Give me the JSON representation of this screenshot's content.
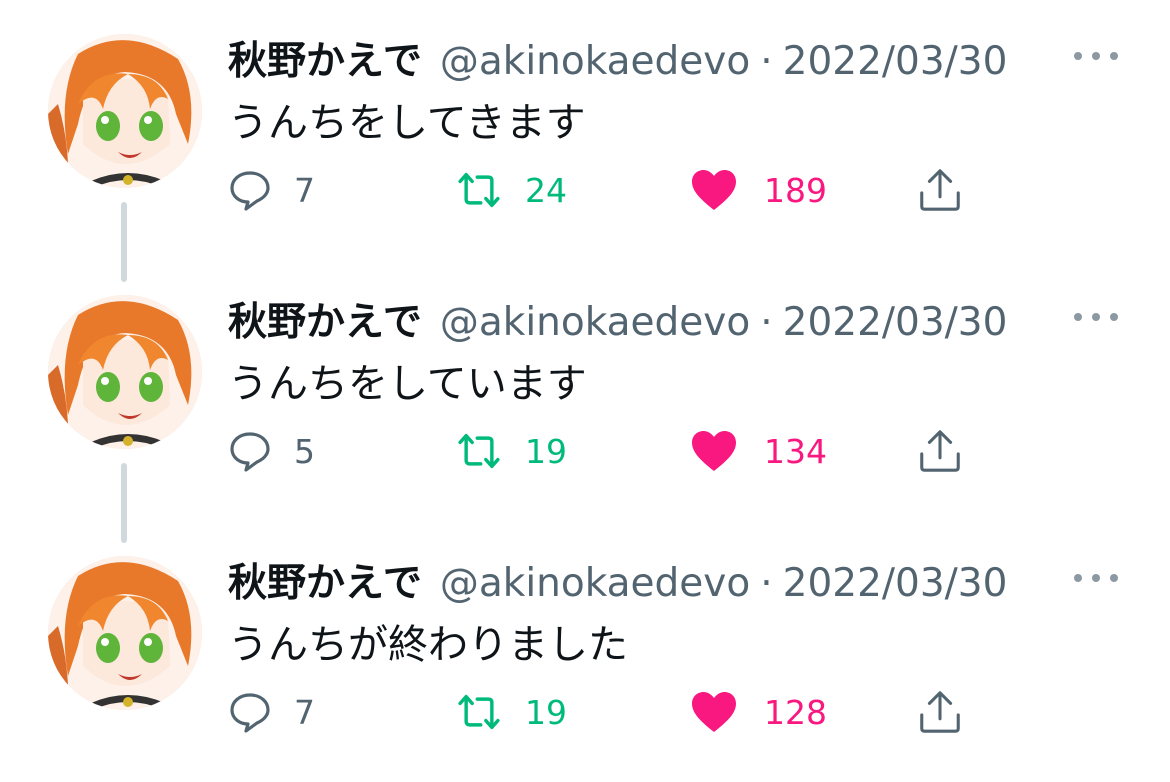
{
  "colors": {
    "name": "#0f1419",
    "secondary": "#536471",
    "retweet": "#00ba7c",
    "like": "#f91880",
    "connector": "#cfd9de"
  },
  "icons": {
    "reply": "speech-bubble-icon",
    "retweet": "retweet-arrows-icon",
    "like": "heart-filled-icon",
    "share": "share-upload-icon",
    "more": "ellipsis-icon"
  },
  "tweets": [
    {
      "name": "秋野かえで",
      "handle": "@akinokaedevo",
      "separator": "·",
      "date": "2022/03/30",
      "text": "うんちをしてきます",
      "replies": "7",
      "retweets": "24",
      "likes": "189"
    },
    {
      "name": "秋野かえで",
      "handle": "@akinokaedevo",
      "separator": "·",
      "date": "2022/03/30",
      "text": "うんちをしています",
      "replies": "5",
      "retweets": "19",
      "likes": "134"
    },
    {
      "name": "秋野かえで",
      "handle": "@akinokaedevo",
      "separator": "·",
      "date": "2022/03/30",
      "text": "うんちが終わりました",
      "replies": "7",
      "retweets": "19",
      "likes": "128"
    }
  ]
}
